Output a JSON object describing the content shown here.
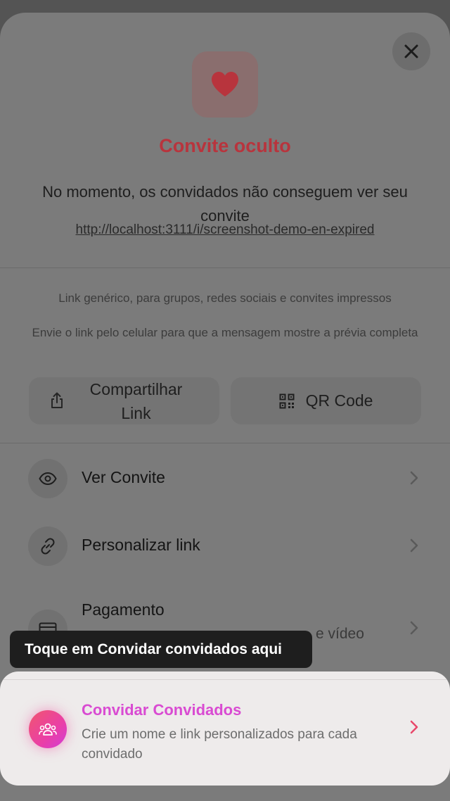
{
  "status": {
    "title": "Convite oculto",
    "description": "No momento, os convidados não conseguem ver seu convite",
    "url": "http://localhost:3111/i/screenshot-demo-en-expired"
  },
  "share": {
    "hint_generic": "Link genérico, para grupos, redes sociais e convites impressos",
    "hint_mobile": "Envie o link pelo celular para que a mensagem mostre a prévia completa",
    "share_link_label": "Compartilhar Link",
    "qr_code_label": "QR Code"
  },
  "menu": {
    "items": [
      {
        "label": "Ver Convite",
        "icon": "eye-icon"
      },
      {
        "label": "Personalizar link",
        "icon": "link-icon"
      },
      {
        "label": "Pagamento",
        "icon": "card-icon",
        "sublabel_partial": "e vídeo"
      }
    ]
  },
  "tooltip": {
    "text": "Toque em Convidar convidados aqui"
  },
  "invite_guests": {
    "title": "Convidar Convidados",
    "description": "Crie um nome e link personalizados para cada convidado",
    "icon": "group-icon"
  },
  "colors": {
    "accent_red": "#b8343d",
    "accent_pink": "#d94bd2",
    "gradient_start": "#f0566f",
    "gradient_end": "#d23cd6"
  }
}
